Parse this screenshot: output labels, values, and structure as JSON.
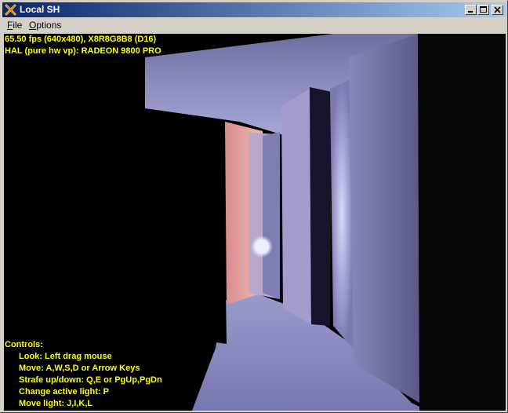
{
  "window": {
    "title": "Local SH",
    "icon": "directx-x-icon",
    "controls": [
      "minimize-icon",
      "maximize-icon",
      "close-icon"
    ]
  },
  "menu": {
    "file_first": "F",
    "file_rest": "ile",
    "options_first": "O",
    "options_rest": "ptions"
  },
  "hud": {
    "stats_line": "65.50 fps (640x480), X8R8G8B8 (D16)",
    "device_line": "HAL (pure hw vp): RADEON 9800 PRO",
    "controls_heading": "Controls:",
    "controls": [
      "Look: Left drag mouse",
      "Move: A,W,S,D or Arrow Keys",
      "Strafe up/down: Q,E or PgUp,PgDn",
      "Change active light: P",
      "Move light: J,I,K,L"
    ],
    "color": "#ffff00"
  },
  "scene": {
    "description_colors": {
      "lavender": "#8c8cc8",
      "pink": "#e8a8a8",
      "background": "#000000"
    }
  }
}
